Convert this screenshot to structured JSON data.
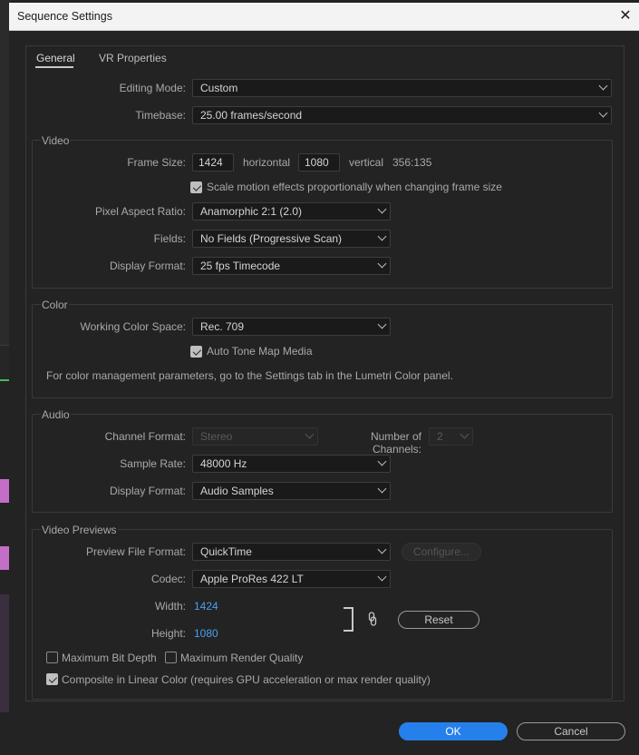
{
  "window": {
    "title": "Sequence Settings",
    "close_glyph": "✕"
  },
  "tabs": [
    {
      "label": "General",
      "active": true
    },
    {
      "label": "VR Properties",
      "active": false
    }
  ],
  "general": {
    "editing_mode": {
      "label": "Editing Mode:",
      "value": "Custom"
    },
    "timebase": {
      "label": "Timebase:",
      "value": "25.00  frames/second"
    }
  },
  "video": {
    "title": "Video",
    "frame_size": {
      "label": "Frame Size:",
      "width": "1424",
      "width_unit": "horizontal",
      "height": "1080",
      "height_unit": "vertical",
      "ratio": "356:135"
    },
    "scale_motion": {
      "label": "Scale motion effects proportionally when changing frame size",
      "checked": true
    },
    "pixel_aspect_ratio": {
      "label": "Pixel Aspect Ratio:",
      "value": "Anamorphic 2:1 (2.0)"
    },
    "fields": {
      "label": "Fields:",
      "value": "No Fields (Progressive Scan)"
    },
    "display_format": {
      "label": "Display Format:",
      "value": "25 fps Timecode"
    }
  },
  "color": {
    "title": "Color",
    "working_color_space": {
      "label": "Working Color Space:",
      "value": "Rec. 709"
    },
    "auto_tone_map": {
      "label": "Auto Tone Map Media",
      "checked": true
    },
    "note": "For color management parameters, go to the Settings tab in the Lumetri Color panel."
  },
  "audio": {
    "title": "Audio",
    "channel_format": {
      "label": "Channel Format:",
      "value": "Stereo",
      "enabled": false
    },
    "number_of_channels": {
      "label": "Number of Channels:",
      "value": "2",
      "enabled": false
    },
    "sample_rate": {
      "label": "Sample Rate:",
      "value": "48000 Hz"
    },
    "display_format": {
      "label": "Display Format:",
      "value": "Audio Samples"
    }
  },
  "video_previews": {
    "title": "Video Previews",
    "preview_file_format": {
      "label": "Preview File Format:",
      "value": "QuickTime"
    },
    "configure_label": "Configure...",
    "codec": {
      "label": "Codec:",
      "value": "Apple ProRes 422 LT"
    },
    "width": {
      "label": "Width:",
      "value": "1424"
    },
    "height": {
      "label": "Height:",
      "value": "1080"
    },
    "link_icon": "link-icon",
    "reset_label": "Reset",
    "max_bit_depth": {
      "label": "Maximum Bit Depth",
      "checked": false
    },
    "max_render_quality": {
      "label": "Maximum Render Quality",
      "checked": false
    },
    "composite_linear": {
      "label": "Composite in Linear Color (requires GPU acceleration or max render quality)",
      "checked": true
    }
  },
  "footer": {
    "ok_label": "OK",
    "cancel_label": "Cancel"
  },
  "colors": {
    "accent": "#2680eb",
    "link_value": "#4a9ff0",
    "background": "#232323"
  }
}
